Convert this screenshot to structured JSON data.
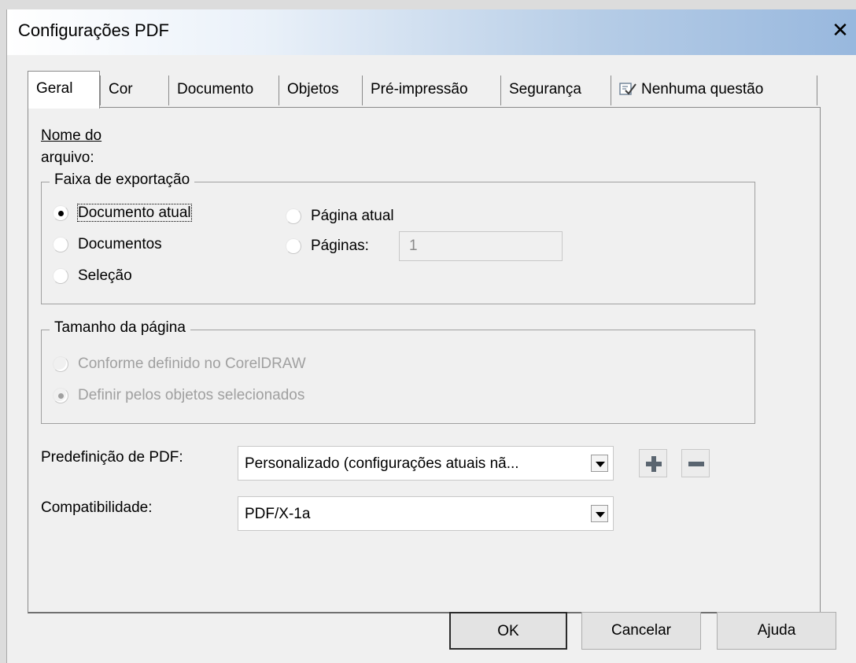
{
  "window": {
    "title": "Configurações PDF",
    "close_glyph": "✕"
  },
  "tabs": [
    {
      "label": "Geral",
      "active": true
    },
    {
      "label": "Cor",
      "active": false
    },
    {
      "label": "Documento",
      "active": false
    },
    {
      "label": "Objetos",
      "active": false
    },
    {
      "label": "Pré-impressão",
      "active": false
    },
    {
      "label": "Segurança",
      "active": false
    },
    {
      "label": "Nenhuma questão",
      "active": false,
      "icon": "checklist-icon"
    }
  ],
  "general": {
    "filename_label_line1": "Nome do",
    "filename_label_line2": "arquivo:",
    "export_range": {
      "title": "Faixa de exportação",
      "options": [
        {
          "label": "Documento atual",
          "checked": true
        },
        {
          "label": "Documentos",
          "checked": false
        },
        {
          "label": "Seleção",
          "checked": false
        },
        {
          "label": "Página atual",
          "checked": false
        },
        {
          "label": "Páginas:",
          "checked": false
        }
      ],
      "pages_value": "1"
    },
    "page_size": {
      "title": "Tamanho da página",
      "options": [
        {
          "label": "Conforme definido no CorelDRAW",
          "checked": false,
          "disabled": true
        },
        {
          "label": "Definir pelos objetos selecionados",
          "checked": true,
          "disabled": true
        }
      ]
    },
    "preset": {
      "label": "Predefinição de PDF:",
      "value": "Personalizado (configurações atuais nã..."
    },
    "compatibility": {
      "label": "Compatibilidade:",
      "value": "PDF/X-1a"
    }
  },
  "buttons": {
    "ok": "OK",
    "cancel": "Cancelar",
    "help": "Ajuda"
  }
}
